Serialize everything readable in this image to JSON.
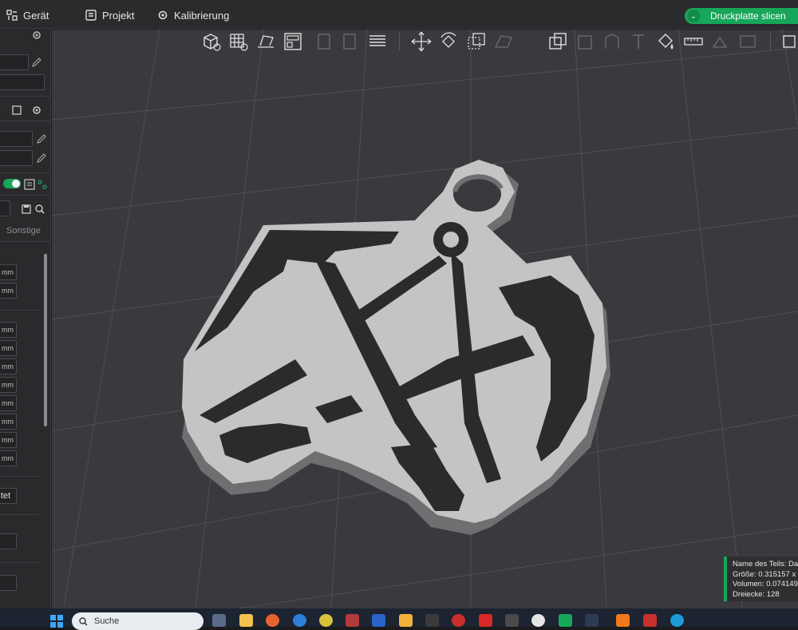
{
  "menu": {
    "device_label": "Gerät",
    "project_label": "Projekt",
    "calibration_label": "Kalibrierung",
    "slice_button_label": "Druckplatte slicen"
  },
  "sidebar": {
    "tab_other_label": "Sonstige",
    "confirmed_fragment": "tet",
    "field_unit": "mm",
    "field_units": [
      "mm",
      "mm",
      "mm",
      "mm",
      "mm",
      "mm",
      "mm",
      "mm",
      "mm",
      "mm"
    ]
  },
  "object_info": {
    "name_line": "Name des Teils: Da",
    "size_line": "Größe: 0.315157 x",
    "volume_line": "Volumen: 0.074149",
    "triangles_line": "Dreiecke: 128"
  },
  "taskbar": {
    "search_placeholder": "Suche"
  },
  "colors": {
    "accent": "#18a65a",
    "viewport_bg": "#3a3a3e",
    "model_light": "#c8c8c8",
    "model_dark": "#2b2b2d"
  },
  "icons": [
    "device-icon",
    "project-icon",
    "calibration-icon",
    "gear-icon",
    "edit-icon",
    "save-icon",
    "search-icon",
    "start-icon"
  ]
}
